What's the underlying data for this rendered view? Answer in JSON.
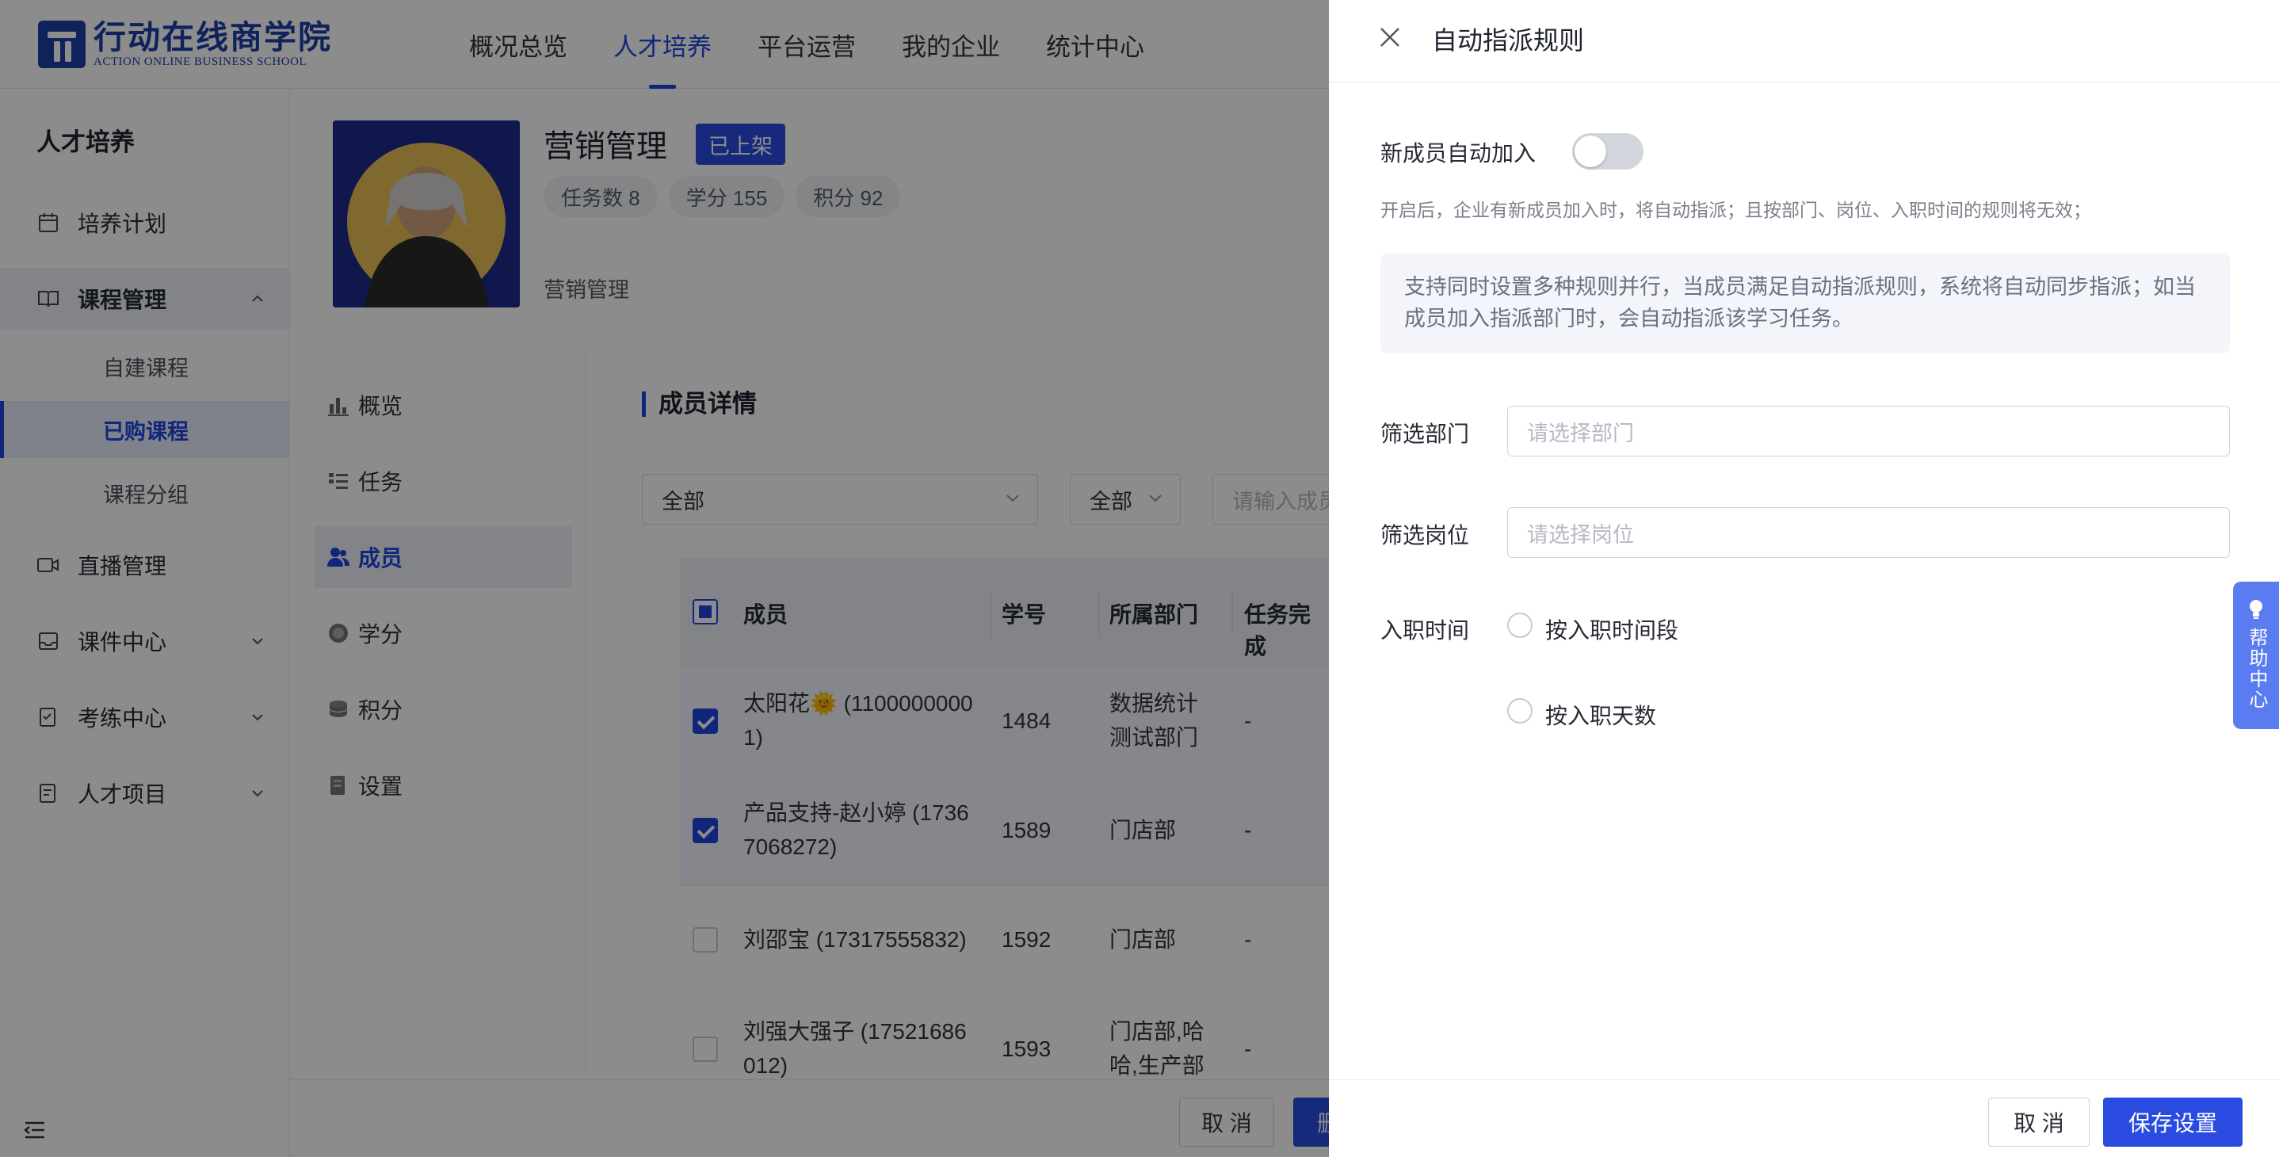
{
  "brand": {
    "name_cn": "行动在线商学院",
    "name_en": "ACTION ONLINE BUSINESS SCHOOL"
  },
  "topnav": [
    {
      "label": "概况总览",
      "active": false
    },
    {
      "label": "人才培养",
      "active": true
    },
    {
      "label": "平台运营",
      "active": false
    },
    {
      "label": "我的企业",
      "active": false
    },
    {
      "label": "统计中心",
      "active": false
    }
  ],
  "sidebar": {
    "title": "人才培养",
    "items": [
      {
        "label": "培养计划",
        "icon": "calendar-icon"
      },
      {
        "label": "课程管理",
        "icon": "book-icon",
        "expanded": true,
        "children": [
          {
            "label": "自建课程",
            "active": false
          },
          {
            "label": "已购课程",
            "active": true
          },
          {
            "label": "课程分组",
            "active": false
          }
        ]
      },
      {
        "label": "直播管理",
        "icon": "video-icon"
      },
      {
        "label": "课件中心",
        "icon": "inbox-icon"
      },
      {
        "label": "考练中心",
        "icon": "exam-icon"
      },
      {
        "label": "人才项目",
        "icon": "project-icon"
      }
    ]
  },
  "course": {
    "name": "营销管理",
    "status": "已上架",
    "stats": [
      "任务数 8",
      "学分 155",
      "积分 92"
    ],
    "description": "营销管理"
  },
  "inner_nav": [
    {
      "label": "概览",
      "icon": "bar-chart-icon",
      "active": false
    },
    {
      "label": "任务",
      "icon": "task-list-icon",
      "active": false
    },
    {
      "label": "成员",
      "icon": "users-icon",
      "active": true
    },
    {
      "label": "学分",
      "icon": "credit-icon",
      "active": false
    },
    {
      "label": "积分",
      "icon": "coins-icon",
      "active": false
    },
    {
      "label": "设置",
      "icon": "settings-icon",
      "active": false
    }
  ],
  "members": {
    "title": "成员详情",
    "filter1": "全部",
    "filter2": "全部",
    "search_placeholder": "请输入成员",
    "columns": [
      "成员",
      "学号",
      "所属部门",
      "任务完成"
    ],
    "rows": [
      {
        "name": "太阳花🌞 (1100000000\n1)",
        "id": "1484",
        "dept": "数据统计\n测试部门",
        "progress": "-",
        "checked": true
      },
      {
        "name": "产品支持-赵小婷 (1736\n7068272)",
        "id": "1589",
        "dept": "门店部",
        "progress": "-",
        "checked": true
      },
      {
        "name": "刘邵宝 (17317555832)",
        "id": "1592",
        "dept": "门店部",
        "progress": "-",
        "checked": false
      },
      {
        "name": "刘强大强子 (17521686\n012)",
        "id": "1593",
        "dept": "门店部,哈\n哈,生产部",
        "progress": "-",
        "checked": false
      }
    ],
    "footer": {
      "cancel": "取 消",
      "primary": "删"
    }
  },
  "drawer": {
    "title": "自动指派规则",
    "auto_join_label": "新成员自动加入",
    "auto_join_enabled": false,
    "hint": "开启后，企业有新成员加入时，将自动指派；且按部门、岗位、入职时间的规则将无效；",
    "info": "支持同时设置多种规则并行，当成员满足自动指派规则，系统将自动同步指派；如当成员加入指派部门时，会自动指派该学习任务。",
    "dept_label": "筛选部门",
    "dept_placeholder": "请选择部门",
    "post_label": "筛选岗位",
    "post_placeholder": "请选择岗位",
    "join_label": "入职时间",
    "join_options": [
      "按入职时间段",
      "按入职天数"
    ],
    "cancel": "取 消",
    "save": "保存设置"
  },
  "help": {
    "label": "帮助中心"
  }
}
